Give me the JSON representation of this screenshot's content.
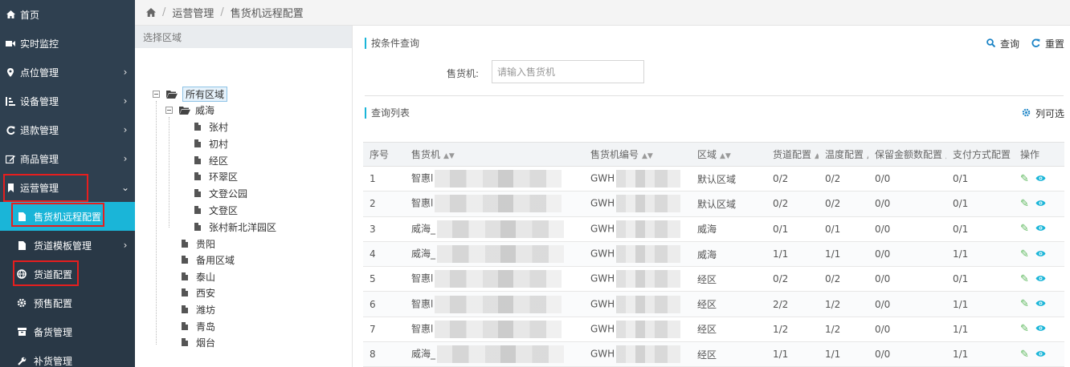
{
  "sidebar": {
    "items": [
      {
        "label": "首页",
        "icon": "home-icon",
        "has_children": false
      },
      {
        "label": "实时监控",
        "icon": "video-camera-icon",
        "has_children": false
      },
      {
        "label": "点位管理",
        "icon": "map-marker-icon",
        "has_children": true
      },
      {
        "label": "设备管理",
        "icon": "sort-icon",
        "has_children": true
      },
      {
        "label": "退款管理",
        "icon": "refresh-icon",
        "has_children": true
      },
      {
        "label": "商品管理",
        "icon": "edit-icon",
        "has_children": true
      },
      {
        "label": "运营管理",
        "icon": "bookmark-icon",
        "has_children": true,
        "expanded": true
      }
    ],
    "sub_items": [
      {
        "label": "售货机远程配置",
        "icon": "file-icon",
        "active": true
      },
      {
        "label": "货道模板管理",
        "icon": "file-icon",
        "has_children": true
      },
      {
        "label": "货道配置",
        "icon": "globe-icon"
      },
      {
        "label": "预售配置",
        "icon": "gear-icon"
      },
      {
        "label": "备货管理",
        "icon": "archive-icon"
      },
      {
        "label": "补货管理",
        "icon": "wrench-icon"
      }
    ]
  },
  "breadcrumb": {
    "items": [
      "运营管理",
      "售货机远程配置"
    ]
  },
  "tree": {
    "header": "选择区域",
    "nodes": [
      {
        "label": "所有区域",
        "type": "folder-open",
        "selected": true
      },
      {
        "label": "威海",
        "type": "folder-open"
      },
      {
        "label": "张村",
        "type": "leaf"
      },
      {
        "label": "初村",
        "type": "leaf"
      },
      {
        "label": "经区",
        "type": "leaf"
      },
      {
        "label": "环翠区",
        "type": "leaf"
      },
      {
        "label": "文登公园",
        "type": "leaf"
      },
      {
        "label": "文登区",
        "type": "leaf"
      },
      {
        "label": "张村新北洋园区",
        "type": "leaf"
      },
      {
        "label": "贵阳",
        "type": "leaf"
      },
      {
        "label": "备用区域",
        "type": "leaf"
      },
      {
        "label": "泰山",
        "type": "leaf"
      },
      {
        "label": "西安",
        "type": "leaf"
      },
      {
        "label": "潍坊",
        "type": "leaf"
      },
      {
        "label": "青岛",
        "type": "leaf"
      },
      {
        "label": "烟台",
        "type": "leaf"
      }
    ]
  },
  "query": {
    "title": "按条件查询",
    "search_label": "查询",
    "reset_label": "重置",
    "field_label": "售货机:",
    "field_placeholder": "请输入售货机",
    "field_value": ""
  },
  "list": {
    "title": "查询列表",
    "columns_label": "列可选",
    "headers": [
      "序号",
      "售货机",
      "售货机编号",
      "区域",
      "货道配置",
      "温度配置",
      "保留金额数配置",
      "支付方式配置",
      "操作"
    ],
    "rows": [
      {
        "idx": "1",
        "vm": "智惠l",
        "code": "GWH",
        "region": "默认区域",
        "channel": "0/2",
        "temp": "0/2",
        "reserve": "0/0",
        "pay": "0/1"
      },
      {
        "idx": "2",
        "vm": "智惠l",
        "code": "GWH",
        "region": "默认区域",
        "channel": "0/2",
        "temp": "0/2",
        "reserve": "0/0",
        "pay": "0/1"
      },
      {
        "idx": "3",
        "vm": "威海_",
        "code": "GWH",
        "region": "威海",
        "channel": "0/1",
        "temp": "0/1",
        "reserve": "0/0",
        "pay": "0/1"
      },
      {
        "idx": "4",
        "vm": "威海_",
        "code": "GWH",
        "region": "威海",
        "channel": "1/1",
        "temp": "1/1",
        "reserve": "0/0",
        "pay": "1/1"
      },
      {
        "idx": "5",
        "vm": "智惠l",
        "code": "GWH",
        "region": "经区",
        "channel": "0/2",
        "temp": "0/2",
        "reserve": "0/0",
        "pay": "0/1"
      },
      {
        "idx": "6",
        "vm": "智惠l",
        "code": "GWH",
        "region": "经区",
        "channel": "2/2",
        "temp": "1/2",
        "reserve": "0/0",
        "pay": "1/1"
      },
      {
        "idx": "7",
        "vm": "智惠l",
        "code": "GWH",
        "region": "经区",
        "channel": "1/2",
        "temp": "1/2",
        "reserve": "0/0",
        "pay": "1/1"
      },
      {
        "idx": "8",
        "vm": "威海_",
        "code": "GWH",
        "region": "经区",
        "channel": "1/1",
        "temp": "1/1",
        "reserve": "0/0",
        "pay": "1/1"
      }
    ]
  },
  "colors": {
    "sidebar_bg": "#2f4050",
    "active_bg": "#1ab5d8",
    "highlight_box": "#e61e1e",
    "accent": "#1c84c6"
  }
}
